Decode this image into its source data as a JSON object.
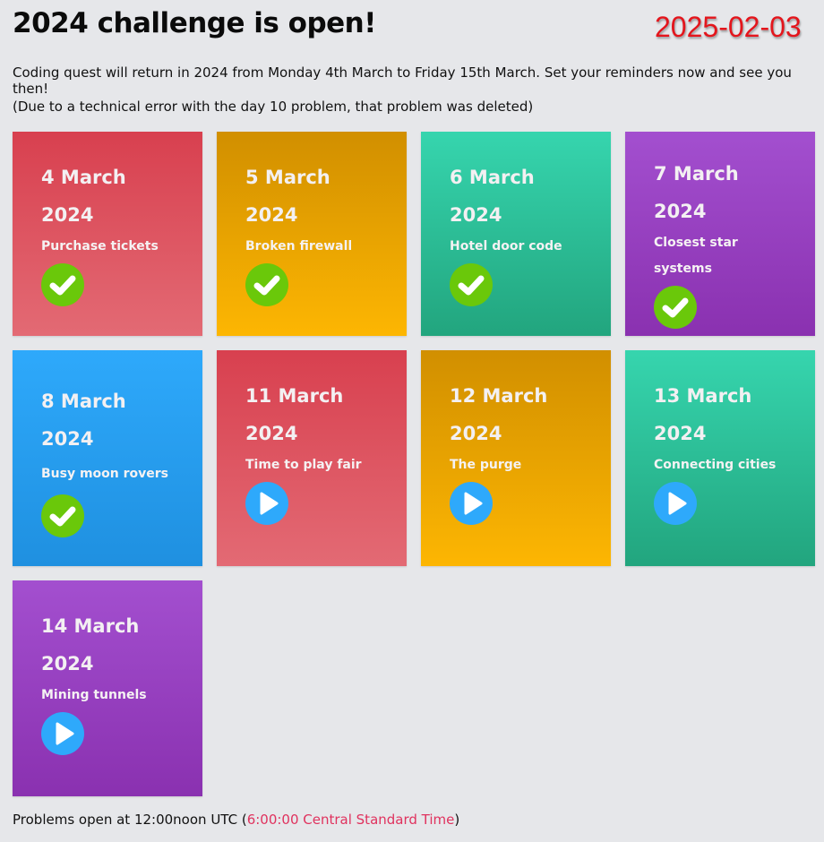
{
  "header": {
    "title": "2024 challenge is open!",
    "date_stamp": "2025-02-03"
  },
  "intro": {
    "line1": "Coding quest will return in 2024 from Monday 4th March to Friday 15th March. Set your reminders now and see you then!",
    "line2": "(Due to a technical error with the day 10 problem, that problem was deleted)"
  },
  "cards": [
    {
      "date": "4 March 2024",
      "name": "Purchase tickets",
      "status": "completed",
      "icon": "check-icon",
      "color": "#d8404f"
    },
    {
      "date": "5 March 2024",
      "name": "Broken firewall",
      "status": "completed",
      "icon": "check-icon",
      "color": "#d18f00"
    },
    {
      "date": "6 March 2024",
      "name": "Hotel door code",
      "status": "completed",
      "icon": "check-icon",
      "color": "#36d5ae"
    },
    {
      "date": "7 March 2024",
      "name": "Closest star systems",
      "status": "completed",
      "icon": "check-icon",
      "color": "#a34fcf"
    },
    {
      "date": "8 March 2024",
      "name": "Busy moon rovers",
      "status": "completed",
      "icon": "check-icon",
      "color": "#2ea9fb"
    },
    {
      "date": "11 March 2024",
      "name": "Time to play fair",
      "status": "open",
      "icon": "play-icon",
      "color": "#d8404f"
    },
    {
      "date": "12 March 2024",
      "name": "The purge",
      "status": "open",
      "icon": "play-icon",
      "color": "#d18f00"
    },
    {
      "date": "13 March 2024",
      "name": "Connecting cities",
      "status": "open",
      "icon": "play-icon",
      "color": "#36d5ae"
    },
    {
      "date": "14 March 2024",
      "name": "Mining tunnels",
      "status": "open",
      "icon": "play-icon",
      "color": "#a34fcf"
    }
  ],
  "colors": {
    "check_circle": "#6ac80a",
    "play_circle": "#2ea9fb",
    "date_stamp": "#e4151c",
    "link": "#e0325e"
  },
  "footer": {
    "prefix": "Problems open at 12:00noon UTC (",
    "local_time": "6:00:00 Central Standard Time",
    "suffix": ")"
  }
}
